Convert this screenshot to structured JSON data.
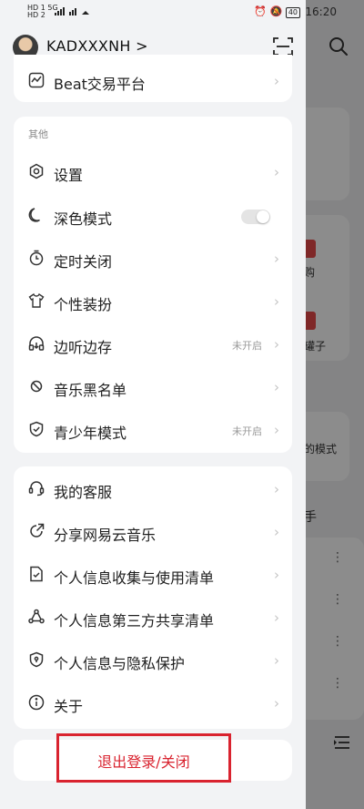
{
  "status_bar": {
    "left_top": "HD 1 5G",
    "left_bottom": "HD 2",
    "signal": "4G",
    "battery": "40",
    "time": "16:20"
  },
  "user": {
    "name": "KADXXXNH >"
  },
  "top_card": {
    "item_label": "Beat交易平台"
  },
  "other_section": {
    "title": "其他",
    "items": [
      {
        "label": "设置",
        "icon": "gear-icon"
      },
      {
        "label": "深色模式",
        "icon": "moon-icon",
        "toggle": "off"
      },
      {
        "label": "定时关闭",
        "icon": "timer-icon"
      },
      {
        "label": "个性装扮",
        "icon": "tshirt-icon"
      },
      {
        "label": "边听边存",
        "icon": "headphones-icon",
        "status": "未开启"
      },
      {
        "label": "音乐黑名单",
        "icon": "block-icon"
      },
      {
        "label": "青少年模式",
        "icon": "shield-icon",
        "status": "未开启"
      }
    ]
  },
  "help_section": {
    "items": [
      {
        "label": "我的客服",
        "icon": "headset-icon"
      },
      {
        "label": "分享网易云音乐",
        "icon": "share-icon"
      },
      {
        "label": "个人信息收集与使用清单",
        "icon": "document-icon"
      },
      {
        "label": "个人信息第三方共享清单",
        "icon": "share-nodes-icon"
      },
      {
        "label": "个人信息与隐私保护",
        "icon": "privacy-shield-icon"
      },
      {
        "label": "关于",
        "icon": "info-icon"
      }
    ]
  },
  "logout": {
    "label": "退出登录/关闭"
  },
  "background": {
    "text_1": "购",
    "text_2": "罐子",
    "text_3": "的模式",
    "text_4": "手"
  },
  "colors": {
    "accent_red": "#d9232f",
    "card_bg": "#ffffff",
    "drawer_bg": "#f2f3f5"
  }
}
